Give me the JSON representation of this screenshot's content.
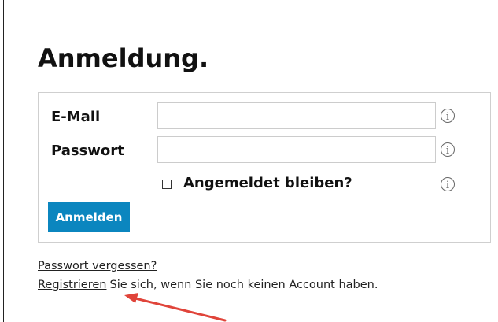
{
  "page": {
    "title": "Anmeldung."
  },
  "form": {
    "email_label": "E-Mail",
    "email_value": "",
    "password_label": "Passwort",
    "password_value": "",
    "remember_label": "Angemeldet bleiben?",
    "remember_checked": false,
    "submit_label": "Anmelden",
    "info_icon": "info-icon"
  },
  "links": {
    "forgot_password": "Passwort vergessen?",
    "register": "Registrieren",
    "register_suffix": "Sie sich, wenn Sie noch keinen Account haben."
  },
  "colors": {
    "button_bg": "#0b86bf",
    "annotation_arrow": "#e0443a"
  }
}
